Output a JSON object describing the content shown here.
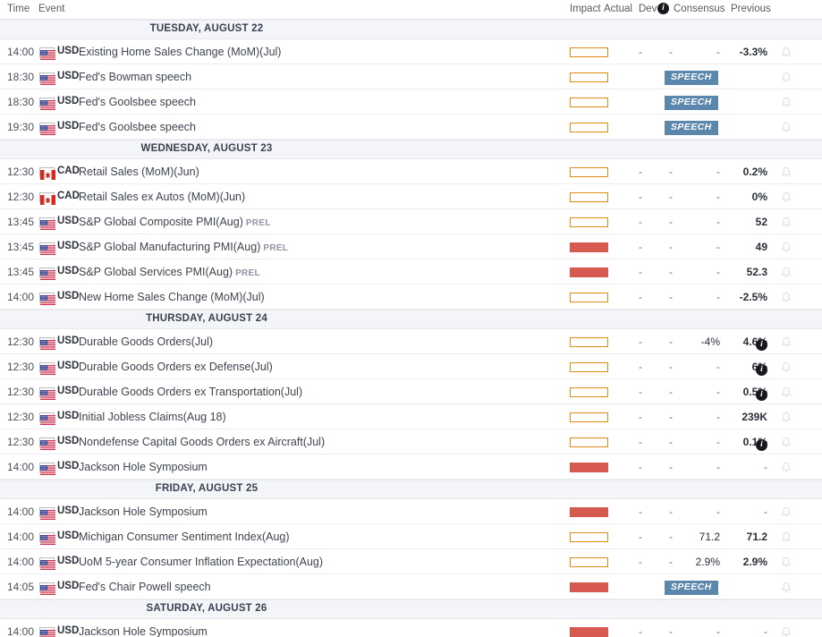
{
  "header": {
    "time": "Time",
    "event": "Event",
    "impact": "Impact",
    "actual": "Actual",
    "dev": "Dev",
    "dev_info_icon": "i",
    "consensus": "Consensus",
    "previous": "Previous"
  },
  "colors": {
    "impact_medium": "#e08a12",
    "impact_high": "#d65a50",
    "speech_badge": "#5b87ad",
    "day_header_bg": "#f4f5f8"
  },
  "legend": {
    "prel_tag": "PREL",
    "speech_tag": "SPEECH",
    "dash": "-",
    "bell_icon": "bell-icon"
  },
  "days": [
    {
      "label": "TUESDAY, AUGUST 22",
      "rows": [
        {
          "time": "14:00",
          "flag": "us-flag",
          "currency": "USD",
          "event": "Existing Home Sales Change (MoM)(Jul)",
          "prel": "",
          "impact": "medium",
          "actual": "-",
          "dev": "-",
          "consensus": "-",
          "previous": "-3.3%",
          "info": false,
          "speech": false
        },
        {
          "time": "18:30",
          "flag": "us-flag",
          "currency": "USD",
          "event": "Fed's Bowman speech",
          "prel": "",
          "impact": "medium",
          "actual": "",
          "dev": "",
          "consensus": "",
          "previous": "",
          "info": false,
          "speech": true
        },
        {
          "time": "18:30",
          "flag": "us-flag",
          "currency": "USD",
          "event": "Fed's Goolsbee speech",
          "prel": "",
          "impact": "medium",
          "actual": "",
          "dev": "",
          "consensus": "",
          "previous": "",
          "info": false,
          "speech": true
        },
        {
          "time": "19:30",
          "flag": "us-flag",
          "currency": "USD",
          "event": "Fed's Goolsbee speech",
          "prel": "",
          "impact": "medium",
          "actual": "",
          "dev": "",
          "consensus": "",
          "previous": "",
          "info": false,
          "speech": true
        }
      ]
    },
    {
      "label": "WEDNESDAY, AUGUST 23",
      "rows": [
        {
          "time": "12:30",
          "flag": "ca-flag",
          "currency": "CAD",
          "event": "Retail Sales (MoM)(Jun)",
          "prel": "",
          "impact": "medium",
          "actual": "-",
          "dev": "-",
          "consensus": "-",
          "previous": "0.2%",
          "info": false,
          "speech": false
        },
        {
          "time": "12:30",
          "flag": "ca-flag",
          "currency": "CAD",
          "event": "Retail Sales ex Autos (MoM)(Jun)",
          "prel": "",
          "impact": "medium",
          "actual": "-",
          "dev": "-",
          "consensus": "-",
          "previous": "0%",
          "info": false,
          "speech": false
        },
        {
          "time": "13:45",
          "flag": "us-flag",
          "currency": "USD",
          "event": "S&P Global Composite PMI(Aug)",
          "prel": "PREL",
          "impact": "medium",
          "actual": "-",
          "dev": "-",
          "consensus": "-",
          "previous": "52",
          "info": false,
          "speech": false
        },
        {
          "time": "13:45",
          "flag": "us-flag",
          "currency": "USD",
          "event": "S&P Global Manufacturing PMI(Aug)",
          "prel": "PREL",
          "impact": "high",
          "actual": "-",
          "dev": "-",
          "consensus": "-",
          "previous": "49",
          "info": false,
          "speech": false
        },
        {
          "time": "13:45",
          "flag": "us-flag",
          "currency": "USD",
          "event": "S&P Global Services PMI(Aug)",
          "prel": "PREL",
          "impact": "high",
          "actual": "-",
          "dev": "-",
          "consensus": "-",
          "previous": "52.3",
          "info": false,
          "speech": false
        },
        {
          "time": "14:00",
          "flag": "us-flag",
          "currency": "USD",
          "event": "New Home Sales Change (MoM)(Jul)",
          "prel": "",
          "impact": "medium",
          "actual": "-",
          "dev": "-",
          "consensus": "-",
          "previous": "-2.5%",
          "info": false,
          "speech": false
        }
      ]
    },
    {
      "label": "THURSDAY, AUGUST 24",
      "rows": [
        {
          "time": "12:30",
          "flag": "us-flag",
          "currency": "USD",
          "event": "Durable Goods Orders(Jul)",
          "prel": "",
          "impact": "medium",
          "actual": "-",
          "dev": "-",
          "consensus": "-4%",
          "previous": "4.6%",
          "info": true,
          "speech": false
        },
        {
          "time": "12:30",
          "flag": "us-flag",
          "currency": "USD",
          "event": "Durable Goods Orders ex Defense(Jul)",
          "prel": "",
          "impact": "medium",
          "actual": "-",
          "dev": "-",
          "consensus": "-",
          "previous": "6%",
          "info": true,
          "speech": false
        },
        {
          "time": "12:30",
          "flag": "us-flag",
          "currency": "USD",
          "event": "Durable Goods Orders ex Transportation(Jul)",
          "prel": "",
          "impact": "medium",
          "actual": "-",
          "dev": "-",
          "consensus": "-",
          "previous": "0.5%",
          "info": true,
          "speech": false
        },
        {
          "time": "12:30",
          "flag": "us-flag",
          "currency": "USD",
          "event": "Initial Jobless Claims(Aug 18)",
          "prel": "",
          "impact": "medium",
          "actual": "-",
          "dev": "-",
          "consensus": "-",
          "previous": "239K",
          "info": false,
          "speech": false
        },
        {
          "time": "12:30",
          "flag": "us-flag",
          "currency": "USD",
          "event": "Nondefense Capital Goods Orders ex Aircraft(Jul)",
          "prel": "",
          "impact": "medium",
          "actual": "-",
          "dev": "-",
          "consensus": "-",
          "previous": "0.1%",
          "info": true,
          "speech": false
        },
        {
          "time": "14:00",
          "flag": "us-flag",
          "currency": "USD",
          "event": "Jackson Hole Symposium",
          "prel": "",
          "impact": "high",
          "actual": "-",
          "dev": "-",
          "consensus": "-",
          "previous": "-",
          "info": false,
          "speech": false
        }
      ]
    },
    {
      "label": "FRIDAY, AUGUST 25",
      "rows": [
        {
          "time": "14:00",
          "flag": "us-flag",
          "currency": "USD",
          "event": "Jackson Hole Symposium",
          "prel": "",
          "impact": "high",
          "actual": "-",
          "dev": "-",
          "consensus": "-",
          "previous": "-",
          "info": false,
          "speech": false
        },
        {
          "time": "14:00",
          "flag": "us-flag",
          "currency": "USD",
          "event": "Michigan Consumer Sentiment Index(Aug)",
          "prel": "",
          "impact": "medium",
          "actual": "-",
          "dev": "-",
          "consensus": "71.2",
          "previous": "71.2",
          "info": false,
          "speech": false
        },
        {
          "time": "14:00",
          "flag": "us-flag",
          "currency": "USD",
          "event": "UoM 5-year Consumer Inflation Expectation(Aug)",
          "prel": "",
          "impact": "medium",
          "actual": "-",
          "dev": "-",
          "consensus": "2.9%",
          "previous": "2.9%",
          "info": false,
          "speech": false
        },
        {
          "time": "14:05",
          "flag": "us-flag",
          "currency": "USD",
          "event": "Fed's Chair Powell speech",
          "prel": "",
          "impact": "high",
          "actual": "",
          "dev": "",
          "consensus": "",
          "previous": "",
          "info": false,
          "speech": true
        }
      ]
    },
    {
      "label": "SATURDAY, AUGUST 26",
      "rows": [
        {
          "time": "14:00",
          "flag": "us-flag",
          "currency": "USD",
          "event": "Jackson Hole Symposium",
          "prel": "",
          "impact": "high",
          "actual": "-",
          "dev": "-",
          "consensus": "-",
          "previous": "-",
          "info": false,
          "speech": false
        }
      ]
    }
  ]
}
